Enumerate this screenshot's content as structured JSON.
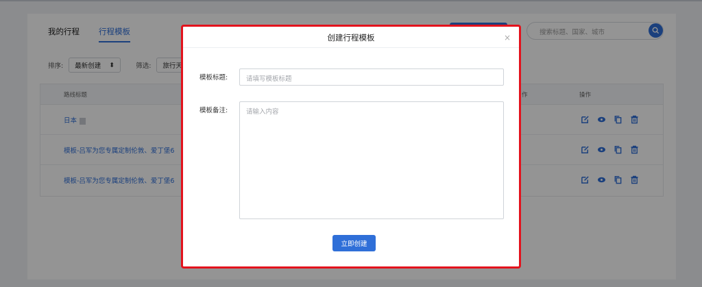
{
  "tabs": [
    {
      "label": "我的行程"
    },
    {
      "label": "行程模板"
    }
  ],
  "search": {
    "placeholder": "搜索标题、国家、城市"
  },
  "filters": {
    "sort_label": "排序:",
    "sort_value": "最新创建",
    "sort_arrow": "⬍",
    "filter_label": "筛选:",
    "filter_value": "旅行天"
  },
  "table": {
    "headers": {
      "title": "路线标题",
      "cut_col": "作",
      "ops": "操作"
    },
    "rows": [
      {
        "title": "日本"
      },
      {
        "title": "模板-吕军为您专属定制伦敦、爱丁堡6"
      },
      {
        "title": "模板-吕军为您专属定制伦敦、爱丁堡6"
      }
    ]
  },
  "modal": {
    "title": "创建行程模板",
    "close": "×",
    "title_label": "模板标题:",
    "title_placeholder": "请填写模板标题",
    "note_label": "模板备注:",
    "note_placeholder": "请输入内容",
    "submit": "立即创建"
  },
  "colors": {
    "accent": "#2f6fd8",
    "highlight_border": "#e3121c"
  }
}
